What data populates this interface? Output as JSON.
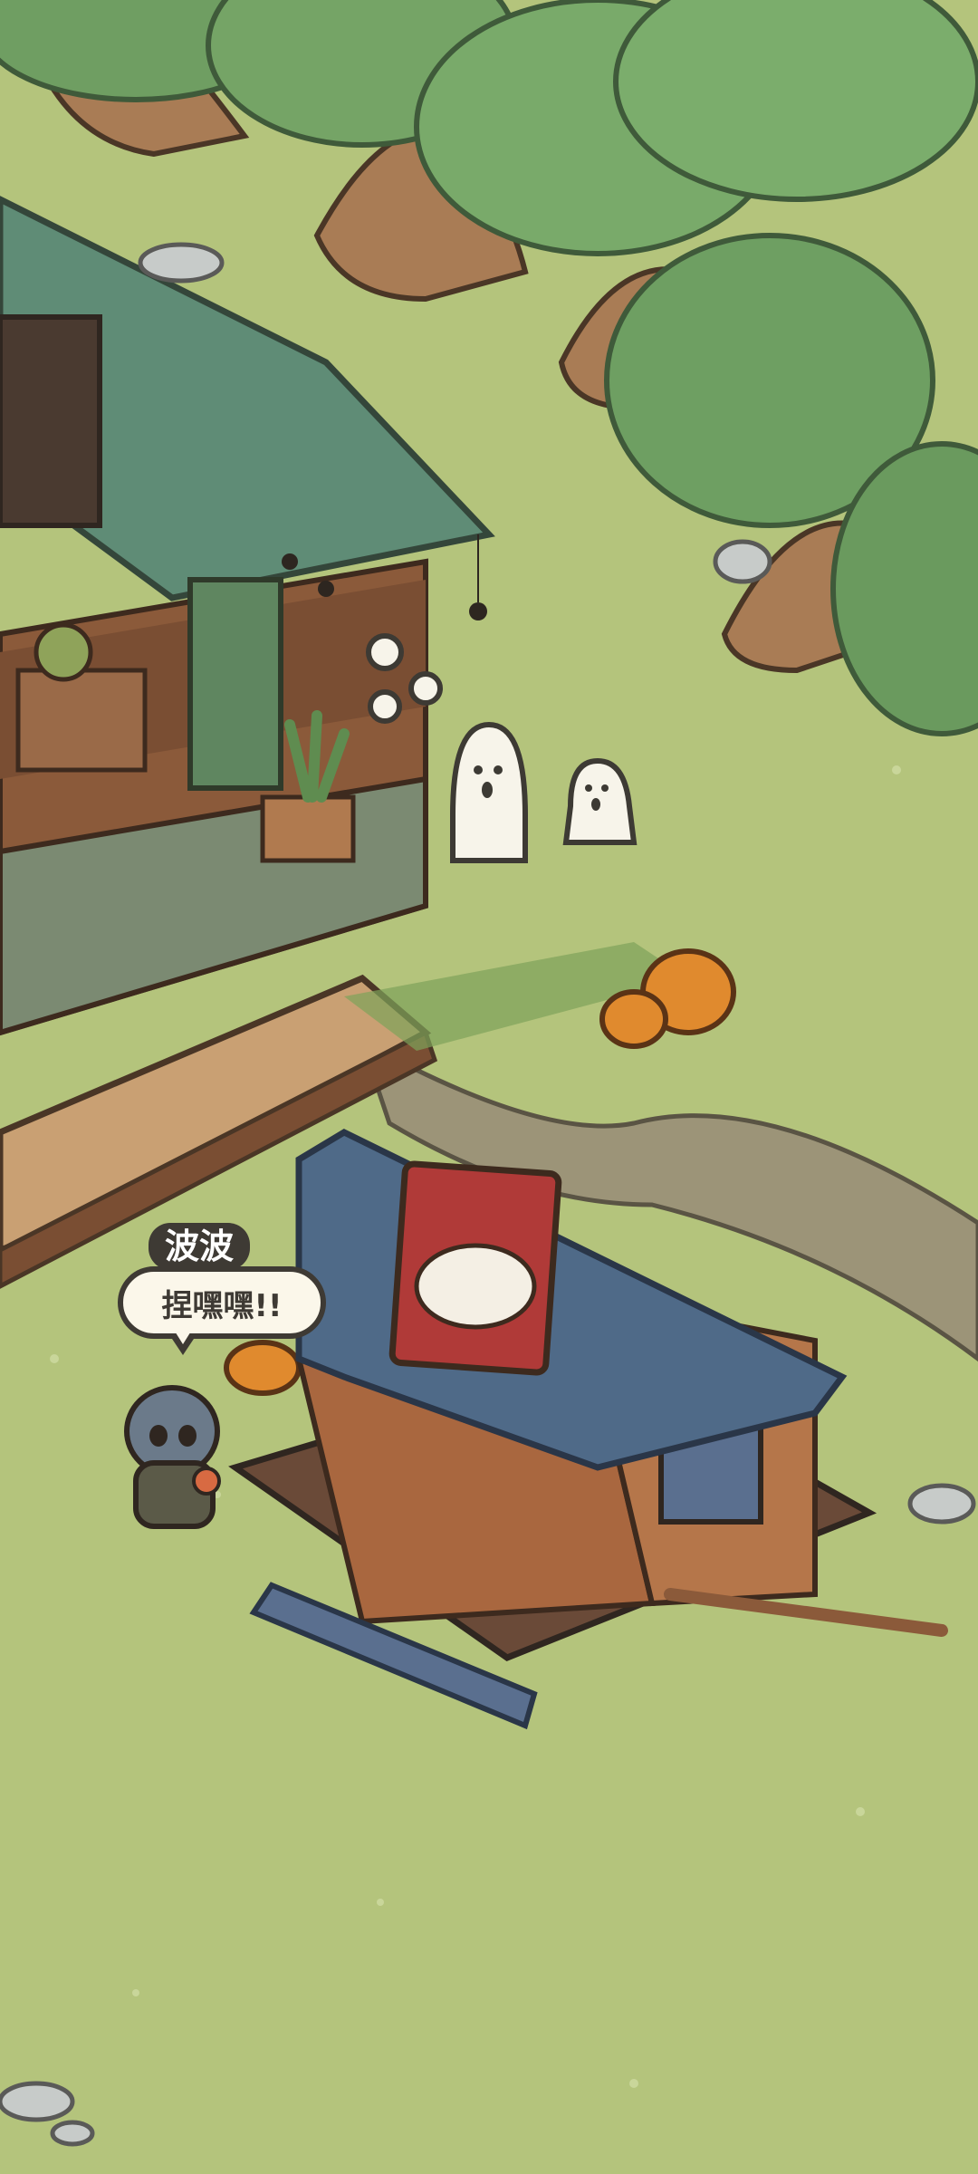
{
  "game": {
    "speech_bubble": {
      "speaker": "波波",
      "text": "捏嘿嘿!!"
    }
  },
  "colors": {
    "grass": "#b4c47c",
    "tree_leaf": "#6c9c60",
    "roof_green": "#5f8c76",
    "roof_blue": "#4f6a88",
    "wood": "#8b5a3a",
    "pumpkin": "#e08a2e"
  }
}
